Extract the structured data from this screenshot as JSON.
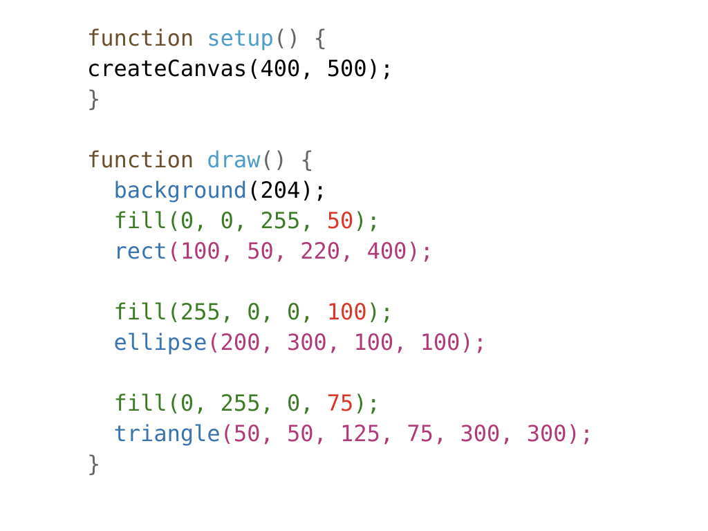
{
  "lines": [
    [
      {
        "text": "function",
        "color": "#6b4f2c"
      },
      {
        "text": " ",
        "color": "#000000"
      },
      {
        "text": "setup",
        "color": "#4d9dc9"
      },
      {
        "text": "() {",
        "color": "#666666"
      }
    ],
    [
      {
        "text": "createCanvas(400, 500);",
        "color": "#000000"
      }
    ],
    [
      {
        "text": "}",
        "color": "#666666"
      }
    ],
    [],
    [
      {
        "text": "function",
        "color": "#6b4f2c"
      },
      {
        "text": " ",
        "color": "#000000"
      },
      {
        "text": "draw",
        "color": "#4d9dc9"
      },
      {
        "text": "() {",
        "color": "#666666"
      }
    ],
    [
      {
        "text": "  ",
        "color": "#000000"
      },
      {
        "text": "background",
        "color": "#3a74b0"
      },
      {
        "text": "(204);",
        "color": "#000000"
      }
    ],
    [
      {
        "text": "  ",
        "color": "#000000"
      },
      {
        "text": "fill(0, 0, 255, ",
        "color": "#3d7a26"
      },
      {
        "text": "50",
        "color": "#d9372a"
      },
      {
        "text": ");",
        "color": "#3d7a26"
      }
    ],
    [
      {
        "text": "  ",
        "color": "#000000"
      },
      {
        "text": "rect",
        "color": "#3a74b0"
      },
      {
        "text": "(100, 50, 220, 400);",
        "color": "#b03a78"
      }
    ],
    [],
    [
      {
        "text": "  ",
        "color": "#000000"
      },
      {
        "text": "fill(255, 0, 0, ",
        "color": "#3d7a26"
      },
      {
        "text": "100",
        "color": "#d9372a"
      },
      {
        "text": ");",
        "color": "#3d7a26"
      }
    ],
    [
      {
        "text": "  ",
        "color": "#000000"
      },
      {
        "text": "ellipse",
        "color": "#3a74b0"
      },
      {
        "text": "(200, 300, 100, 100);",
        "color": "#b03a78"
      }
    ],
    [],
    [
      {
        "text": "  ",
        "color": "#000000"
      },
      {
        "text": "fill(0, 255, 0, ",
        "color": "#3d7a26"
      },
      {
        "text": "75",
        "color": "#d9372a"
      },
      {
        "text": ");",
        "color": "#3d7a26"
      }
    ],
    [
      {
        "text": "  ",
        "color": "#000000"
      },
      {
        "text": "triangle",
        "color": "#3a74b0"
      },
      {
        "text": "(50, 50, 125, 75, 300, 300);",
        "color": "#b03a78"
      }
    ],
    [
      {
        "text": "}",
        "color": "#666666"
      }
    ]
  ]
}
